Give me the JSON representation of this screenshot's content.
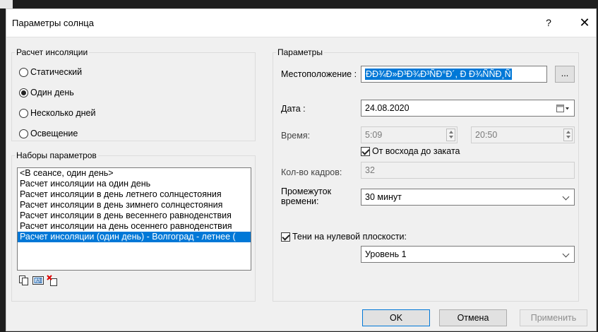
{
  "dialog": {
    "title": "Параметры солнца",
    "help_glyph": "?",
    "close_glyph": "✕"
  },
  "insolation": {
    "legend": "Расчет инсоляции",
    "options": [
      {
        "label": "Статический",
        "checked": false
      },
      {
        "label": "Один день",
        "checked": true
      },
      {
        "label": "Несколько дней",
        "checked": false
      },
      {
        "label": "Освещение",
        "checked": false
      }
    ]
  },
  "presets": {
    "legend": "Наборы параметров",
    "items": [
      "<В сеансе, один день>",
      "Расчет инсоляции на один день",
      "Расчет инсоляции в день летнего солнцестояния",
      "Расчет инсоляции в день зимнего солнцестояния",
      "Расчет инсоляции в день весеннего равноденствия",
      "Расчет инсоляции на день осеннего равноденствия",
      "Расчет инсоляции (один день) - Волгоград - летнее (",
      "",
      ""
    ],
    "selected_index": 6,
    "icons": [
      "duplicate-icon",
      "rename-icon",
      "delete-icon"
    ]
  },
  "params": {
    "legend": "Параметры",
    "location_label": "Местоположение :",
    "location_value": "ÐÐ¾Ð»Ð³Ð¾Ð³ÑÐ°Ð´, Ð Ð¾ÑÑÐ¸Ñ",
    "browse_label": "...",
    "date_label": "Дата :",
    "date_value": "24.08.2020",
    "time_label": "Время:",
    "time_start": "5:09",
    "time_end": "20:50",
    "sunrise_label": "От восхода до заката",
    "sunrise_checked": true,
    "frames_label": "Кол-во кадров:",
    "frames_value": "32",
    "interval_label": "Промежуток времени:",
    "interval_value": "30 минут",
    "shadows_label": "Тени на нулевой плоскости:",
    "shadows_checked": true,
    "level_value": "Уровень 1"
  },
  "buttons": {
    "ok": "OK",
    "cancel": "Отмена",
    "apply": "Применить"
  },
  "colors": {
    "selection": "#0078d7",
    "dialog_bg": "#f0f0f0"
  }
}
